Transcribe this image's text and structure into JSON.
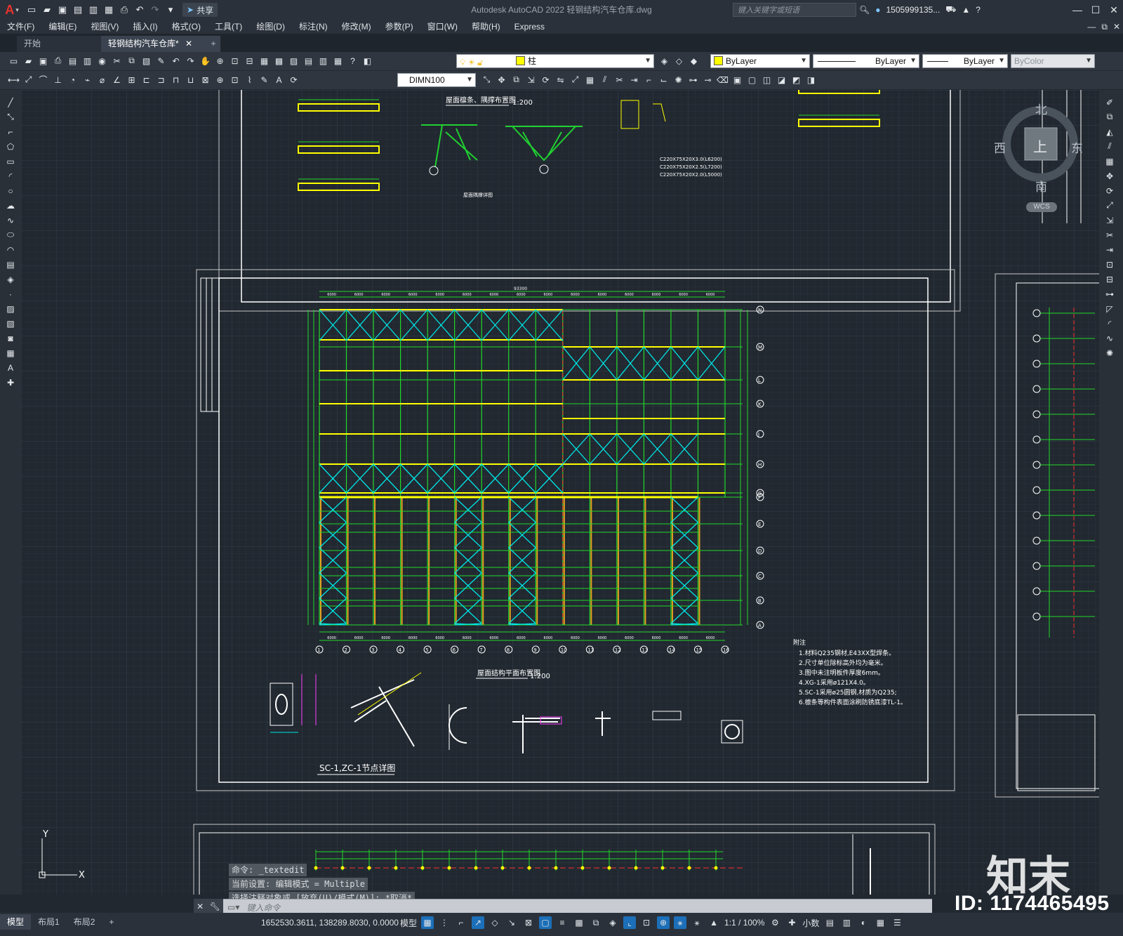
{
  "app": {
    "title": "Autodesk AutoCAD 2022    轻钢结构汽车仓库.dwg",
    "share_label": "共享",
    "search_placeholder": "键入关键字或短语",
    "user": "1505999135..."
  },
  "menu": [
    "文件(F)",
    "编辑(E)",
    "视图(V)",
    "插入(I)",
    "格式(O)",
    "工具(T)",
    "绘图(D)",
    "标注(N)",
    "修改(M)",
    "参数(P)",
    "窗口(W)",
    "帮助(H)",
    "Express"
  ],
  "tabs": {
    "start": "开始",
    "doc": "轻钢结构汽车仓库*",
    "add": "+"
  },
  "toolbar": {
    "layer": "柱",
    "color": "ByLayer",
    "linetype": "ByLayer",
    "lineweight": "ByLayer",
    "plotstyle": "ByColor",
    "dimstyle": "DIMN100"
  },
  "viewcube": {
    "north": "北",
    "south": "南",
    "east": "东",
    "west": "西",
    "top": "上",
    "wcs": "WCS"
  },
  "drawing": {
    "title_top": "屋面檩条、隅撑布置图",
    "scale_top": "1:200",
    "title_plan": "屋面结构平面布置图",
    "scale_plan": "1:200",
    "title_detail": "SC-1,ZC-1节点详图",
    "detail_label": "屋面隅撑详图",
    "notes_title": "附注",
    "notes": [
      "1.材料Q235钢材,E43XX型焊条。",
      "2.尺寸单位除标高外均为毫米。",
      "3.图中未注明板件厚度6mm。",
      "4.XG-1采用ø121X4.0。",
      "5.SC-1采用ø25圆钢,材质为Q235;",
      "6.檩条等构件表面涂刷防锈底漆TL-1。"
    ],
    "grid_cols": [
      "1",
      "2",
      "3",
      "4",
      "5",
      "6",
      "7",
      "8",
      "9",
      "10",
      "11",
      "12",
      "13",
      "14",
      "15",
      "16"
    ],
    "grid_rows": [
      "A",
      "B",
      "C",
      "D",
      "E",
      "F",
      "G",
      "H",
      "J",
      "K",
      "L",
      "M",
      "N"
    ],
    "dim_total": "93300",
    "dim_bay": "6000",
    "purlin_specs": [
      "C220X75X20X3.0(L6200)",
      "C220X75X20X2.5(L7200)",
      "C220X75X20X2.0(L5000)"
    ]
  },
  "command": {
    "history": [
      "命令: _textedit",
      "当前设置: 编辑模式 = Multiple",
      "选择注释对象或 [放弃(U)/模式(M)]: *取消*"
    ],
    "placeholder": "键入命令"
  },
  "status": {
    "layouts": [
      "模型",
      "布局1",
      "布局2"
    ],
    "add": "+",
    "coords": "1652530.3611, 138289.8030, 0.0000",
    "space": "模型",
    "scale": "1:1 / 100%",
    "units": "小数"
  },
  "watermark": {
    "logo": "知末",
    "id": "ID: 1174465495"
  },
  "colors": {
    "canvas": "#212830",
    "grid_green": "#22d82a",
    "yellow_purlin": "#ffff00",
    "cyan_brace": "#00e5e5",
    "orange_column": "#e8a020",
    "red_axis": "#ff3030"
  }
}
